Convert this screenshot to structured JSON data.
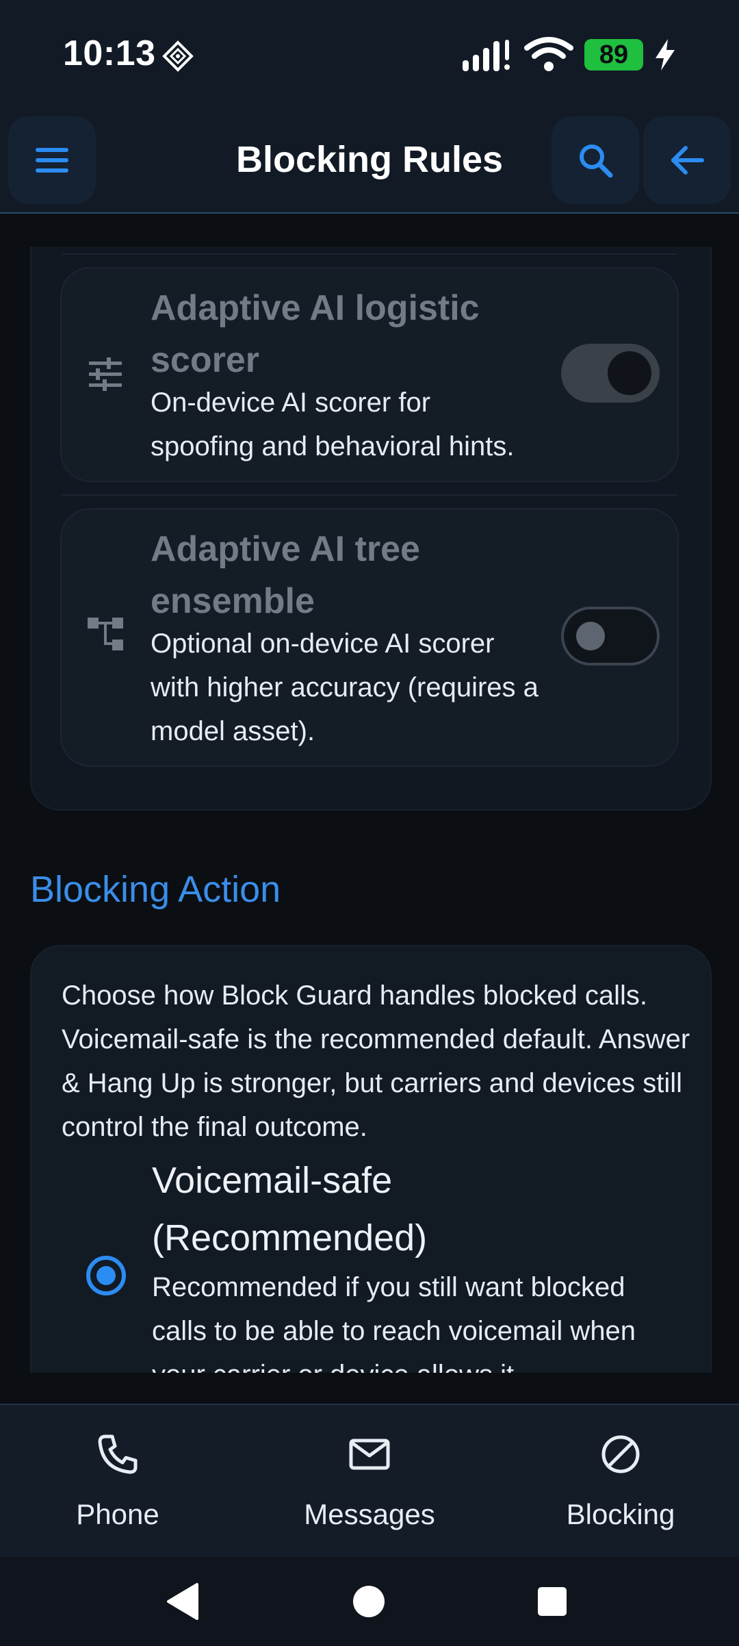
{
  "status_bar": {
    "time": "10:13",
    "battery": "89",
    "icons": [
      "diamond-notification-icon",
      "signal-icon",
      "wifi-icon",
      "charging-bolt-icon"
    ]
  },
  "top_bar": {
    "title": "Blocking Rules",
    "icons": [
      "menu-icon",
      "search-icon",
      "back-arrow-icon"
    ]
  },
  "scorers": [
    {
      "title": "Adaptive AI logistic scorer",
      "description": "On-device AI scorer for spoofing and behavioral hints.",
      "icon": "sliders-icon",
      "enabled": true
    },
    {
      "title": "Adaptive AI tree ensemble",
      "description": "Optional on-device AI scorer with higher accuracy (requires a model asset).",
      "icon": "tree-structure-icon",
      "enabled": false
    }
  ],
  "blocking_action": {
    "section_title": "Blocking Action",
    "description": "Choose how Block Guard handles blocked calls. Voicemail-safe is the recommended default. Answer & Hang Up is stronger, but carriers and devices still control the final outcome.",
    "options": [
      {
        "title": "Voicemail-safe (Recommended)",
        "description": "Recommended if you still want blocked calls to be able to reach voicemail when your carrier or device allows it.",
        "selected": true
      }
    ]
  },
  "bottom_nav": {
    "items": [
      {
        "label": "Phone",
        "icon": "phone-icon"
      },
      {
        "label": "Messages",
        "icon": "mail-icon"
      },
      {
        "label": "Blocking",
        "icon": "block-icon"
      }
    ]
  },
  "colors": {
    "accent": "#2b8cf2",
    "background": "#0b0e12",
    "bar": "#121a26"
  }
}
